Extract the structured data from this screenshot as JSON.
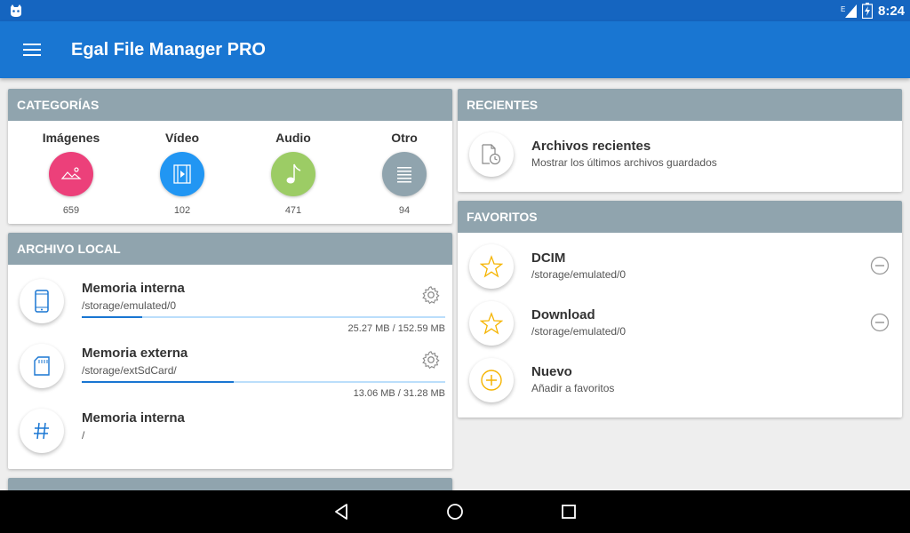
{
  "status": {
    "time": "8:24",
    "network": "E"
  },
  "appbar": {
    "title": "Egal File Manager PRO"
  },
  "categories": {
    "header": "CATEGORÍAS",
    "items": [
      {
        "label": "Imágenes",
        "count": "659",
        "color": "#ec407a",
        "icon": "image-icon"
      },
      {
        "label": "Vídeo",
        "count": "102",
        "color": "#2196f3",
        "icon": "video-icon"
      },
      {
        "label": "Audio",
        "count": "471",
        "color": "#9ccc65",
        "icon": "music-icon"
      },
      {
        "label": "Otro",
        "count": "94",
        "color": "#90a4ae",
        "icon": "document-icon"
      }
    ]
  },
  "local": {
    "header": "ARCHIVO LOCAL",
    "items": [
      {
        "name": "Memoria interna",
        "path": "/storage/emulated/0",
        "size": "25.27 MB / 152.59 MB",
        "used_fraction": 0.166
      },
      {
        "name": "Memoria externa",
        "path": "/storage/extSdCard/",
        "size": "13.06 MB / 31.28 MB",
        "used_fraction": 0.418
      },
      {
        "name": "Memoria interna",
        "path": "/"
      }
    ]
  },
  "recent": {
    "header": "RECIENTES",
    "name": "Archivos recientes",
    "desc": "Mostrar los últimos archivos guardados"
  },
  "favorites": {
    "header": "FAVORITOS",
    "items": [
      {
        "name": "DCIM",
        "path": "/storage/emulated/0"
      },
      {
        "name": "Download",
        "path": "/storage/emulated/0"
      },
      {
        "name": "Nuevo",
        "path": "Añadir a favoritos"
      }
    ]
  },
  "colors": {
    "primary": "#1976d2",
    "status": "#1565c0",
    "header": "#90a4ae",
    "accent": "#f5b400"
  }
}
